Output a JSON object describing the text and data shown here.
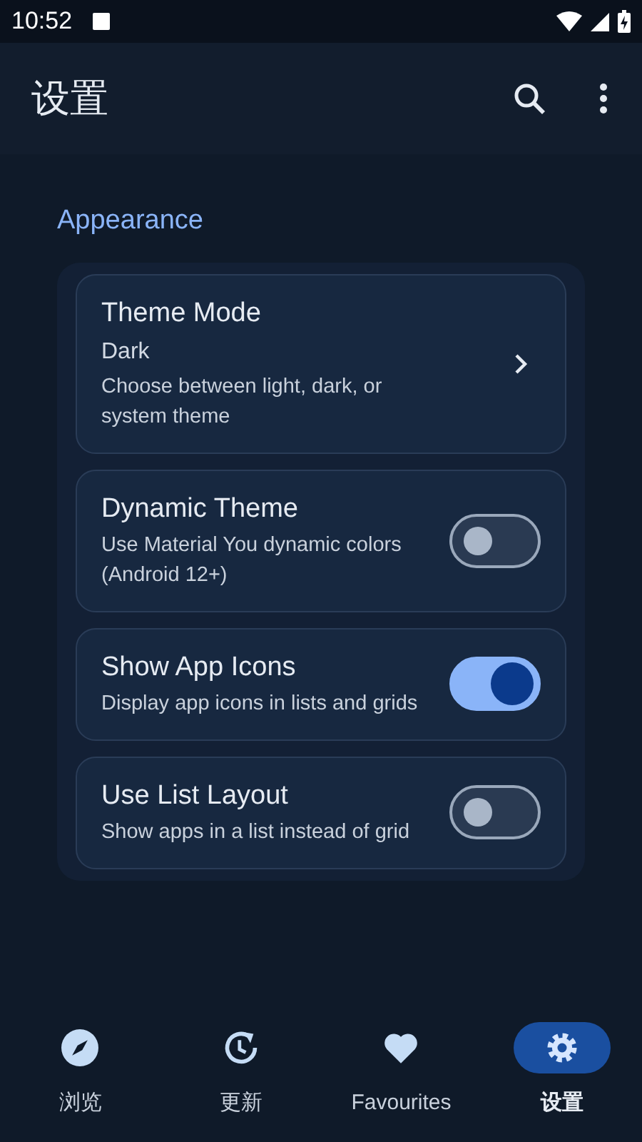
{
  "status_bar": {
    "time": "10:52"
  },
  "app_bar": {
    "title": "设置"
  },
  "section": {
    "title": "Appearance"
  },
  "settings": [
    {
      "kind": "link",
      "title": "Theme Mode",
      "value": "Dark",
      "description": "Choose between light, dark, or system theme"
    },
    {
      "kind": "switch",
      "title": "Dynamic Theme",
      "description": "Use Material You dynamic colors (Android 12+)",
      "on": false
    },
    {
      "kind": "switch",
      "title": "Show App Icons",
      "description": "Display app icons in lists and grids",
      "on": true
    },
    {
      "kind": "switch",
      "title": "Use List Layout",
      "description": "Show apps in a list instead of grid",
      "on": false
    }
  ],
  "nav": [
    {
      "kind": "compass",
      "label": "浏览",
      "selected": false
    },
    {
      "kind": "history",
      "label": "更新",
      "selected": false
    },
    {
      "kind": "heart",
      "label": "Favourites",
      "selected": false
    },
    {
      "kind": "gear",
      "label": "设置",
      "selected": true
    }
  ]
}
